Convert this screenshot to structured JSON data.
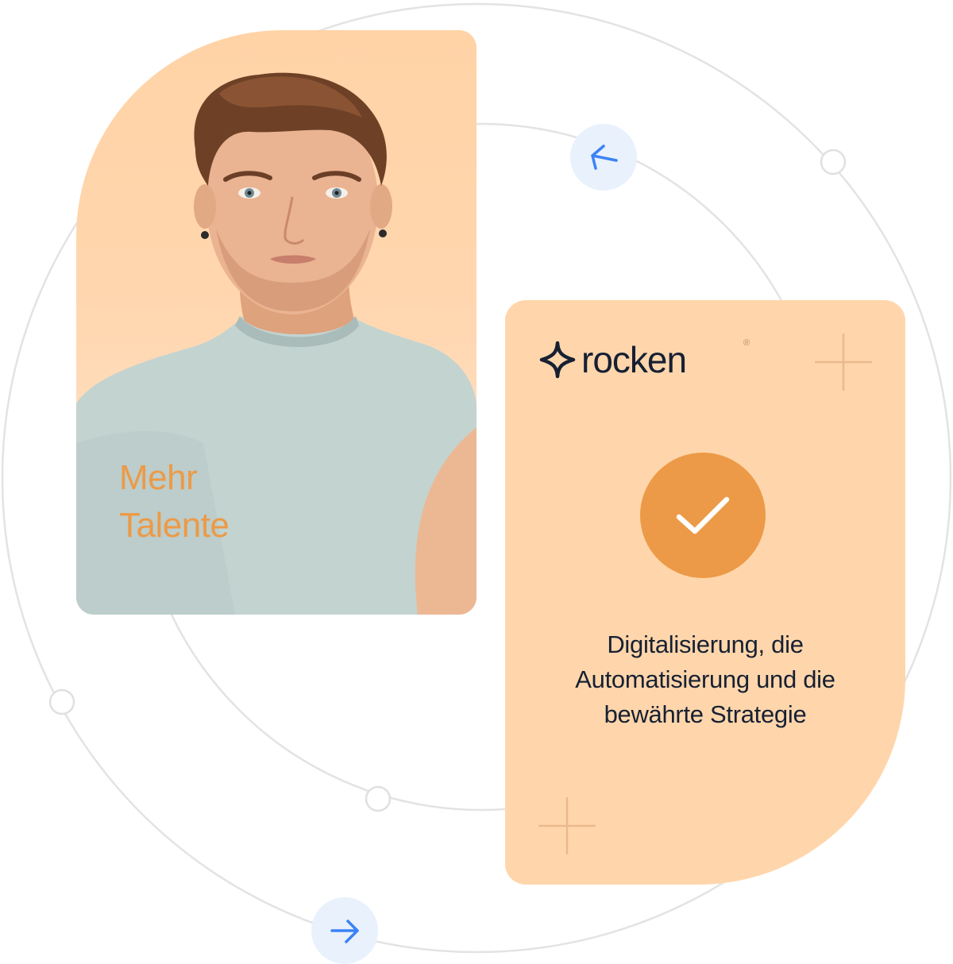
{
  "photo_card": {
    "caption_line1": "Mehr",
    "caption_line2": "Talente"
  },
  "info_card": {
    "brand_name": "rocken",
    "brand_reg": "®",
    "text_line1": "Digitalisierung, die",
    "text_line2": "Automatisierung und die",
    "text_line3": "bewährte Strategie"
  },
  "icons": {
    "arrow_top": "arrow-left-icon",
    "arrow_bottom": "arrow-right-icon",
    "check": "checkmark-icon",
    "brand": "rocken-star-logo"
  },
  "colors": {
    "accent_orange": "#ec9a47",
    "card_peach": "#ffd6ab",
    "dark_text": "#172033",
    "arrow_blue": "#3b82f6",
    "arrow_bg": "#e9f1fd",
    "orbit_gray": "#e3e3e3"
  }
}
